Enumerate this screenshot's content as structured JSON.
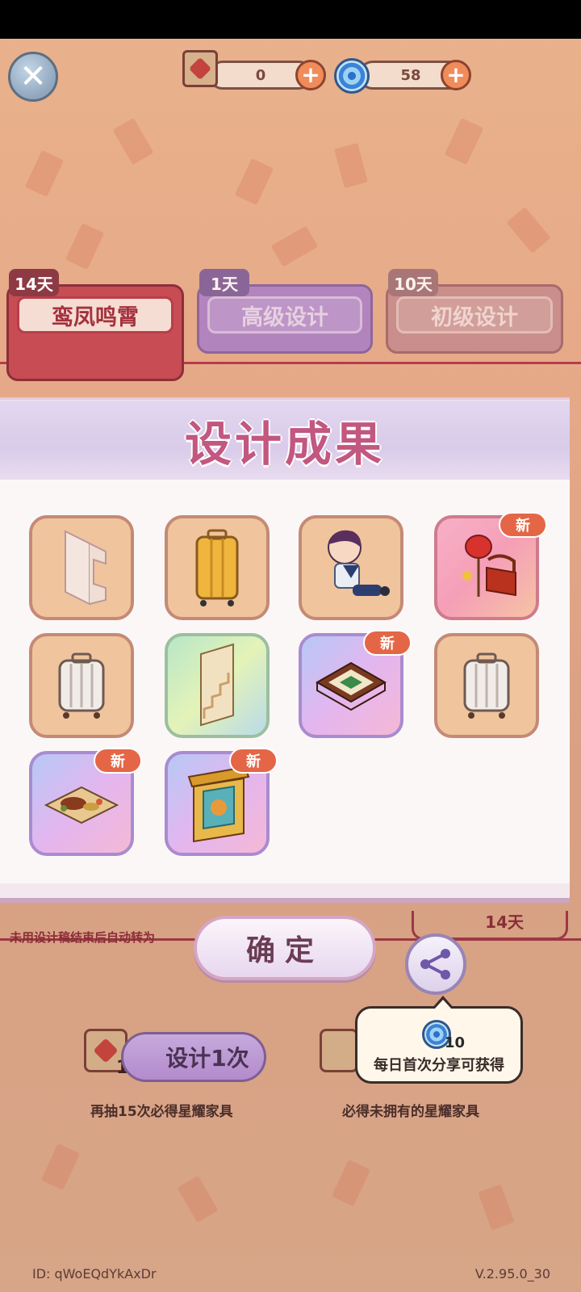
{
  "currency": {
    "design_scrolls": "0",
    "star_swirl": "58",
    "plus": "+"
  },
  "tabs": [
    {
      "days": "14天",
      "label": "鸾凤鸣霄",
      "active": true
    },
    {
      "days": "1天",
      "label": "高级设计",
      "active": false
    },
    {
      "days": "10天",
      "label": "初级设计",
      "active": false
    }
  ],
  "result_panel": {
    "title": "设计成果",
    "items": [
      {
        "name": "wall-arch",
        "new": false
      },
      {
        "name": "yellow-suitcase",
        "new": false
      },
      {
        "name": "doll-character",
        "new": false
      },
      {
        "name": "red-lantern-chair",
        "new": true
      },
      {
        "name": "white-suitcase",
        "new": false
      },
      {
        "name": "staircase-door",
        "new": false
      },
      {
        "name": "game-board-table",
        "new": true
      },
      {
        "name": "white-suitcase",
        "new": false
      },
      {
        "name": "food-platter",
        "new": true
      },
      {
        "name": "ornate-gate",
        "new": true
      }
    ],
    "new_badge": "新",
    "confirm": "确定"
  },
  "bottom": {
    "hint": "未用设计稿结束后自动转为",
    "days_box": "14天",
    "design_button": "设计1次",
    "scroll_count": "1",
    "sub_left": "再抽15次必得星耀家具",
    "sub_right": "必得未拥有的星耀家具"
  },
  "tooltip": {
    "reward_count": "10",
    "text": "每日首次分享可获得"
  },
  "footer": {
    "id": "ID:  qWoEQdYkAxDr",
    "version": "V.2.95.0_30"
  },
  "colors": {
    "accent_red": "#c84c54",
    "title_pink": "#c25780",
    "badge_orange": "#e46646"
  }
}
